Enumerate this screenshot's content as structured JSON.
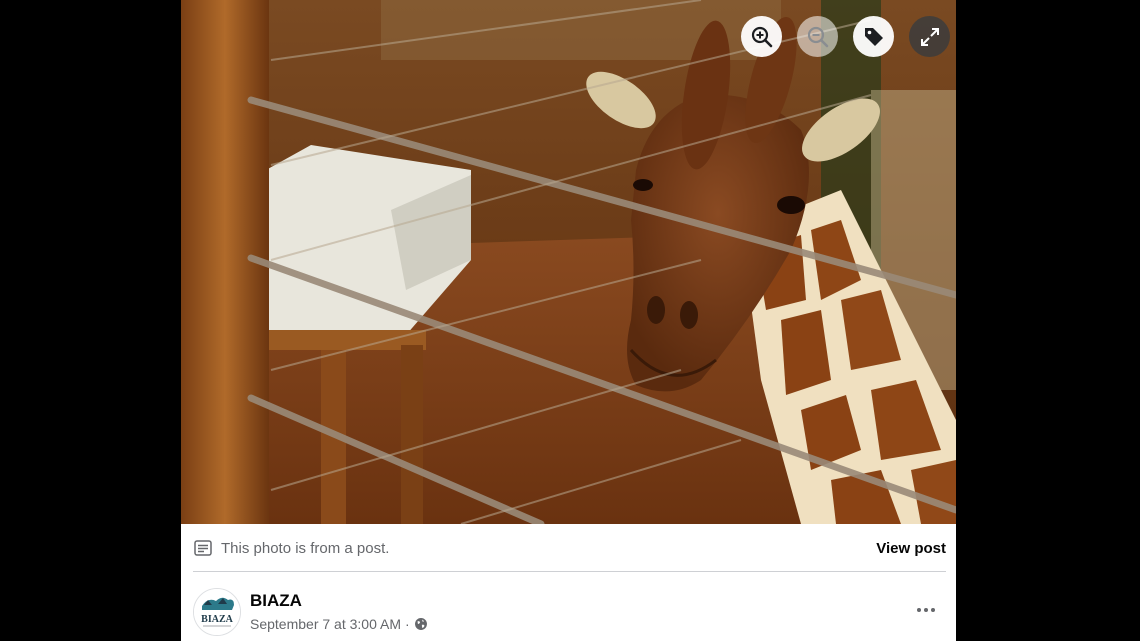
{
  "photo": {
    "alt_subject": "giraffe",
    "controls": [
      {
        "name": "zoom-in-icon"
      },
      {
        "name": "zoom-out-icon"
      },
      {
        "name": "tag-icon"
      },
      {
        "name": "fullscreen-icon"
      }
    ]
  },
  "post_notice": {
    "text": "This photo is from a post.",
    "link_label": "View post",
    "icon": "post-text-icon"
  },
  "author": {
    "name": "BIAZA",
    "avatar_text": "BIAZA",
    "date": "September 7 at 3:00 AM",
    "separator": "·",
    "privacy_icon": "globe-icon"
  },
  "colors": {
    "text_primary": "#050505",
    "text_secondary": "#65676b",
    "divider": "#ced0d4",
    "background": "#000000"
  }
}
